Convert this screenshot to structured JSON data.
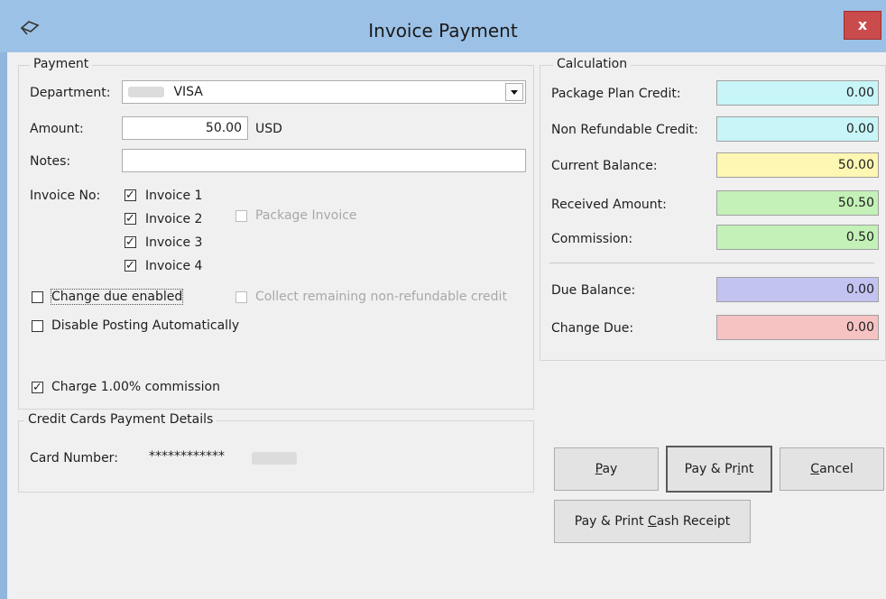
{
  "window": {
    "title": "Invoice Payment",
    "close_label": "x"
  },
  "payment": {
    "group_title": "Payment",
    "department_label": "Department:",
    "department_value": "VISA",
    "amount_label": "Amount:",
    "amount_value": "50.00",
    "currency": "USD",
    "notes_label": "Notes:",
    "notes_value": "",
    "invoice_label": "Invoice No:",
    "invoices": [
      {
        "label": "Invoice 1",
        "checked": true
      },
      {
        "label": "Invoice 2",
        "checked": true
      },
      {
        "label": "Invoice 3",
        "checked": true
      },
      {
        "label": "Invoice 4",
        "checked": true
      }
    ],
    "package_invoice_label": "Package Invoice",
    "change_due_label": "Change due enabled",
    "collect_label": "Collect remaining non-refundable credit",
    "disable_posting_label": "Disable Posting Automatically",
    "commission_label": "Charge 1.00% commission"
  },
  "credit_card": {
    "group_title": "Credit Cards Payment Details",
    "card_label": "Card Number:",
    "card_value": "************"
  },
  "calculation": {
    "group_title": "Calculation",
    "rows": [
      {
        "label": "Package Plan Credit:",
        "value": "0.00",
        "color": "#c8f5f7"
      },
      {
        "label": "Non Refundable Credit:",
        "value": "0.00",
        "color": "#c8f5f7"
      },
      {
        "label": "Current Balance:",
        "value": "50.00",
        "color": "#fdf7b3"
      },
      {
        "label": "Received Amount:",
        "value": "50.50",
        "color": "#c3f1b7"
      },
      {
        "label": "Commission:",
        "value": "0.50",
        "color": "#c3f1b7"
      },
      {
        "label": "Due Balance:",
        "value": "0.00",
        "color": "#c3c3f1"
      },
      {
        "label": "Change Due:",
        "value": "0.00",
        "color": "#f6c2c2"
      }
    ]
  },
  "buttons": {
    "pay_first": "P",
    "pay_rest": "ay",
    "pay_print_a": "Pay & Pr",
    "pay_print_u": "i",
    "pay_print_b": "nt",
    "cancel_first": "C",
    "cancel_rest": "ancel",
    "cash_a": "Pay & Print ",
    "cash_u": "C",
    "cash_b": "ash Receipt"
  }
}
